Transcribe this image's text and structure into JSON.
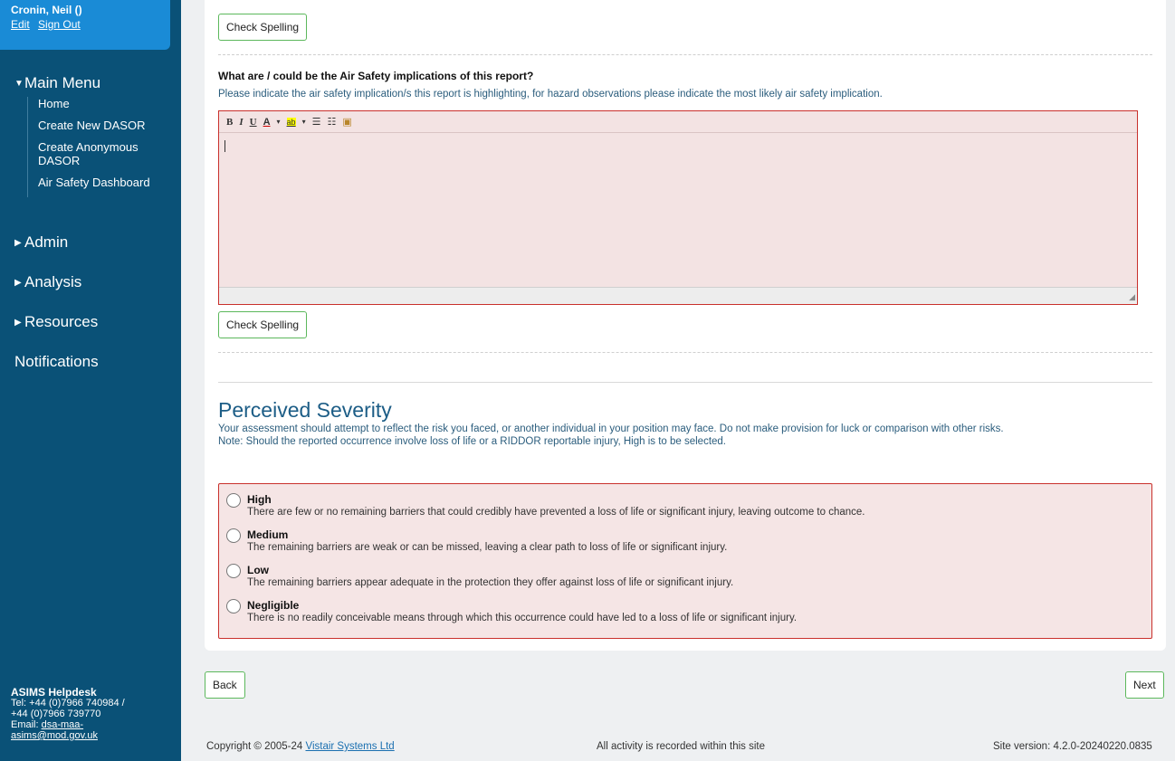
{
  "user": {
    "name": "Cronin, Neil ()",
    "edit": "Edit",
    "sign_out": "Sign Out"
  },
  "sidebar": {
    "main_menu": "Main Menu",
    "items": [
      "Home",
      "Create New DASOR",
      "Create Anonymous DASOR",
      "Air Safety Dashboard"
    ],
    "admin": "Admin",
    "analysis": "Analysis",
    "resources": "Resources",
    "notifications": "Notifications"
  },
  "helpdesk": {
    "title": "ASIMS Helpdesk",
    "tel1": "Tel: +44 (0)7966 740984 /",
    "tel2": "+44 (0)7966 739770",
    "email_label": "Email:",
    "email_part1": "dsa-maa-",
    "email_part2": "asims@mod.gov.uk"
  },
  "form": {
    "check_spelling": "Check Spelling",
    "question": "What are / could be the Air Safety implications of this report?",
    "question_help": "Please indicate the air safety implication/s this report is highlighting, for hazard observations please indicate the most likely air safety implication.",
    "editor_value": "",
    "toolbar": {
      "bold": "B",
      "italic": "I",
      "underline": "U",
      "font_color": "A",
      "highlight": "ab",
      "bullets": "☰",
      "numbers": "☷",
      "paste": "▣"
    }
  },
  "severity": {
    "title": "Perceived Severity",
    "desc1": "Your assessment should attempt to reflect the risk you faced, or another individual in your position may face. Do not make provision for luck or comparison with other risks.",
    "desc2": "Note: Should the reported occurrence involve loss of life or a RIDDOR reportable injury, High is to be selected.",
    "options": [
      {
        "label": "High",
        "desc": "There are few or no remaining barriers that could credibly have prevented a loss of life or significant injury, leaving outcome to chance."
      },
      {
        "label": "Medium",
        "desc": "The remaining barriers are weak or can be missed, leaving a clear path to loss of life or significant injury."
      },
      {
        "label": "Low",
        "desc": "The remaining barriers appear adequate in the protection they offer against loss of life or significant injury."
      },
      {
        "label": "Negligible",
        "desc": "There is no readily conceivable means through which this occurrence could have led to a loss of life or significant injury."
      }
    ]
  },
  "nav": {
    "back": "Back",
    "next": "Next"
  },
  "footer": {
    "copyright": "Copyright © 2005-24 ",
    "company": "Vistair Systems Ltd",
    "activity": "All activity is recorded within this site",
    "version": "Site version: 4.2.0-20240220.0835"
  },
  "colors": {
    "sidebar": "#0a5177",
    "user_box": "#1a8bd6",
    "error_border": "#c9302c",
    "button_border": "#5cb85c",
    "heading": "#1c5d86"
  }
}
